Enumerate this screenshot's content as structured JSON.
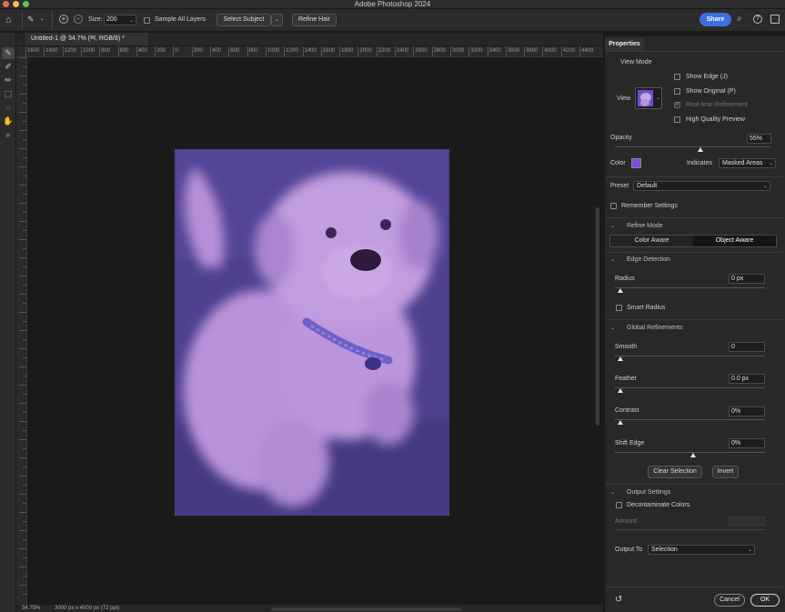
{
  "app_title": "Adobe Photoshop 2024",
  "options_bar": {
    "size_label": "Size:",
    "size_value": "200",
    "sample_all_layers": "Sample All Layers",
    "select_subject": "Select Subject",
    "refine_hair": "Refine Hair",
    "share": "Share"
  },
  "document": {
    "tab_title": "Untitled-1 @ 34.7% (ग्ग, RGB/8) *",
    "ruler_labels": [
      "1600",
      "1400",
      "1200",
      "1000",
      "800",
      "600",
      "400",
      "200",
      "0",
      "200",
      "400",
      "600",
      "800",
      "1000",
      "1200",
      "1400",
      "1600",
      "1800",
      "2000",
      "2200",
      "2400",
      "2600",
      "2800",
      "3000",
      "3200",
      "3400",
      "3600",
      "3800",
      "4000",
      "4200",
      "4400"
    ],
    "status_zoom": "34.75%",
    "status_size": "3000 px x 4000 px (72 ppi)"
  },
  "properties": {
    "tab": "Properties",
    "view_mode": {
      "title": "View Mode",
      "view_label": "View",
      "show_edge": "Show Edge (J)",
      "show_original": "Show Original (P)",
      "realtime_refinement": "Real-time Refinement",
      "high_quality_preview": "High Quality Preview"
    },
    "opacity_label": "Opacity",
    "opacity_value": "55%",
    "opacity_level": 0.55,
    "color_label": "Color",
    "overlay_color": "#7b4fd9",
    "indicates_label": "Indicates",
    "indicates_value": "Masked Areas",
    "preset_label": "Preset",
    "preset_value": "Default",
    "remember_settings": "Remember Settings",
    "refine_mode": {
      "title": "Refine Mode",
      "color_aware": "Color Aware",
      "object_aware": "Object Aware",
      "selected": "Object Aware"
    },
    "edge_detection": {
      "title": "Edge Detection",
      "radius_label": "Radius",
      "radius_value": "0 px",
      "smart_radius": "Smart Radius"
    },
    "global_refinements": {
      "title": "Global Refinements",
      "smooth_label": "Smooth",
      "smooth_value": "0",
      "feather_label": "Feather",
      "feather_value": "0.0 px",
      "contrast_label": "Contrast",
      "contrast_value": "0%",
      "shift_edge_label": "Shift Edge",
      "shift_edge_value": "0%"
    },
    "clear_selection": "Clear Selection",
    "invert": "Invert",
    "output_settings": {
      "title": "Output Settings",
      "decontaminate_colors": "Decontaminate Colors",
      "amount_label": "Amount",
      "output_to_label": "Output To",
      "output_to_value": "Selection"
    },
    "cancel": "Cancel",
    "ok": "OK"
  },
  "colors": {
    "share_button": "#3b6fe0",
    "overlay": "#7b4fd9"
  }
}
